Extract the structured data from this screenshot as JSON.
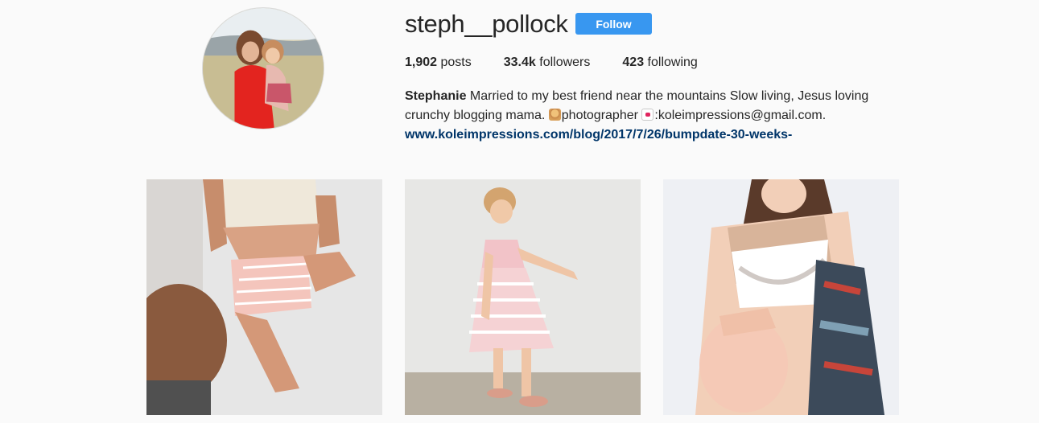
{
  "profile": {
    "username": "steph__pollock",
    "follow_label": "Follow",
    "stats": {
      "posts_count": "1,902",
      "posts_label": "posts",
      "followers_count": "33.4k",
      "followers_label": "followers",
      "following_count": "423",
      "following_label": "following"
    },
    "bio": {
      "name": "Stephanie",
      "text_line1": "Married to my best friend near the mountains Slow living, Jesus loving",
      "text_line2_a": "crunchy blogging mama.",
      "text_line2_b": "photographer",
      "text_line2_c": ":koleimpressions@gmail.com.",
      "link": "www.koleimpressions.com/blog/2017/7/26/bumpdate-30-weeks-"
    },
    "icons": [
      "woman-photographer-emoji",
      "love-letter-emoji"
    ]
  },
  "posts": [
    {
      "name": "post-1"
    },
    {
      "name": "post-2"
    },
    {
      "name": "post-3"
    }
  ],
  "colors": {
    "follow_button": "#3897f0",
    "link": "#003569",
    "background": "#fafafa"
  }
}
